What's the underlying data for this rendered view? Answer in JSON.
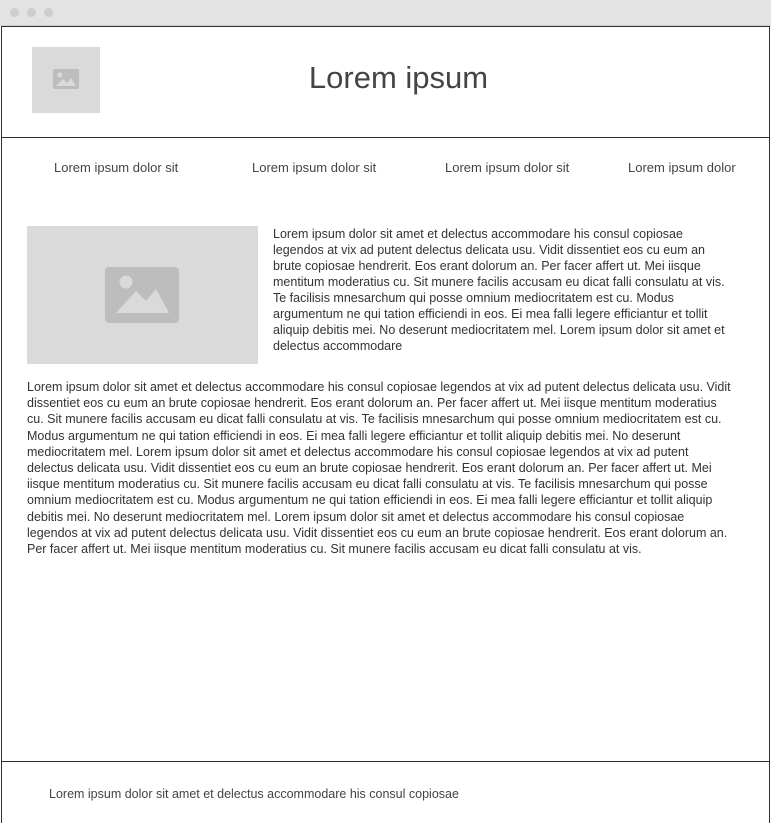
{
  "window": {
    "controls": [
      "close",
      "minimize",
      "maximize"
    ],
    "control_color": "#cdcdcd"
  },
  "header": {
    "logo_icon": "image-placeholder-icon",
    "title": "Lorem ipsum"
  },
  "nav": {
    "items": [
      {
        "label": "Lorem ipsum dolor sit"
      },
      {
        "label": "Lorem ipsum dolor sit"
      },
      {
        "label": "Lorem ipsum dolor sit"
      },
      {
        "label": "Lorem ipsum dolor"
      }
    ]
  },
  "main": {
    "hero_image_icon": "image-placeholder-icon",
    "side_paragraph": "Lorem ipsum dolor sit amet et delectus accommodare his consul copiosae legendos at vix ad putent delectus delicata usu. Vidit dissentiet eos cu eum an brute copiosae hendrerit. Eos erant dolorum an. Per facer affert ut. Mei iisque mentitum moderatius cu. Sit munere facilis accusam eu dicat falli consulatu at vis. Te facilisis mnesarchum qui posse omnium mediocritatem est cu. Modus argumentum ne qui tation efficiendi in eos. Ei mea falli legere efficiantur et tollit aliquip debitis mei. No deserunt mediocritatem mel. Lorem ipsum dolor sit amet et delectus accommodare",
    "body_paragraph": "Lorem ipsum dolor sit amet et delectus accommodare his consul copiosae legendos at vix ad putent delectus delicata usu. Vidit dissentiet eos cu eum an brute copiosae hendrerit. Eos erant dolorum an. Per facer affert ut. Mei iisque mentitum moderatius cu. Sit munere facilis accusam eu dicat falli consulatu at vis. Te facilisis mnesarchum qui posse omnium mediocritatem est cu. Modus argumentum ne qui tation efficiendi in eos. Ei mea falli legere efficiantur et tollit aliquip debitis mei. No deserunt mediocritatem mel. Lorem ipsum dolor sit amet et delectus accommodare his consul copiosae legendos at vix ad putent delectus delicata usu. Vidit dissentiet eos cu eum an brute copiosae hendrerit. Eos erant dolorum an. Per facer affert ut. Mei iisque mentitum moderatius cu. Sit munere facilis accusam eu dicat falli consulatu at vis. Te facilisis mnesarchum qui posse omnium mediocritatem est cu. Modus argumentum ne qui tation efficiendi in eos. Ei mea falli legere efficiantur et tollit aliquip debitis mei. No deserunt mediocritatem mel. Lorem ipsum dolor sit amet et delectus accommodare his consul copiosae legendos at vix ad putent delectus delicata usu. Vidit dissentiet eos cu eum an brute copiosae hendrerit. Eos erant dolorum an. Per facer affert ut. Mei iisque mentitum moderatius cu. Sit munere facilis accusam eu dicat falli consulatu at vis."
  },
  "footer": {
    "text": "Lorem ipsum dolor sit amet et delectus accommodare his consul copiosae"
  },
  "colors": {
    "placeholder_bg": "#dadada",
    "placeholder_icon": "#bdbdbd",
    "border": "#2f2f2f",
    "text": "#333333"
  }
}
